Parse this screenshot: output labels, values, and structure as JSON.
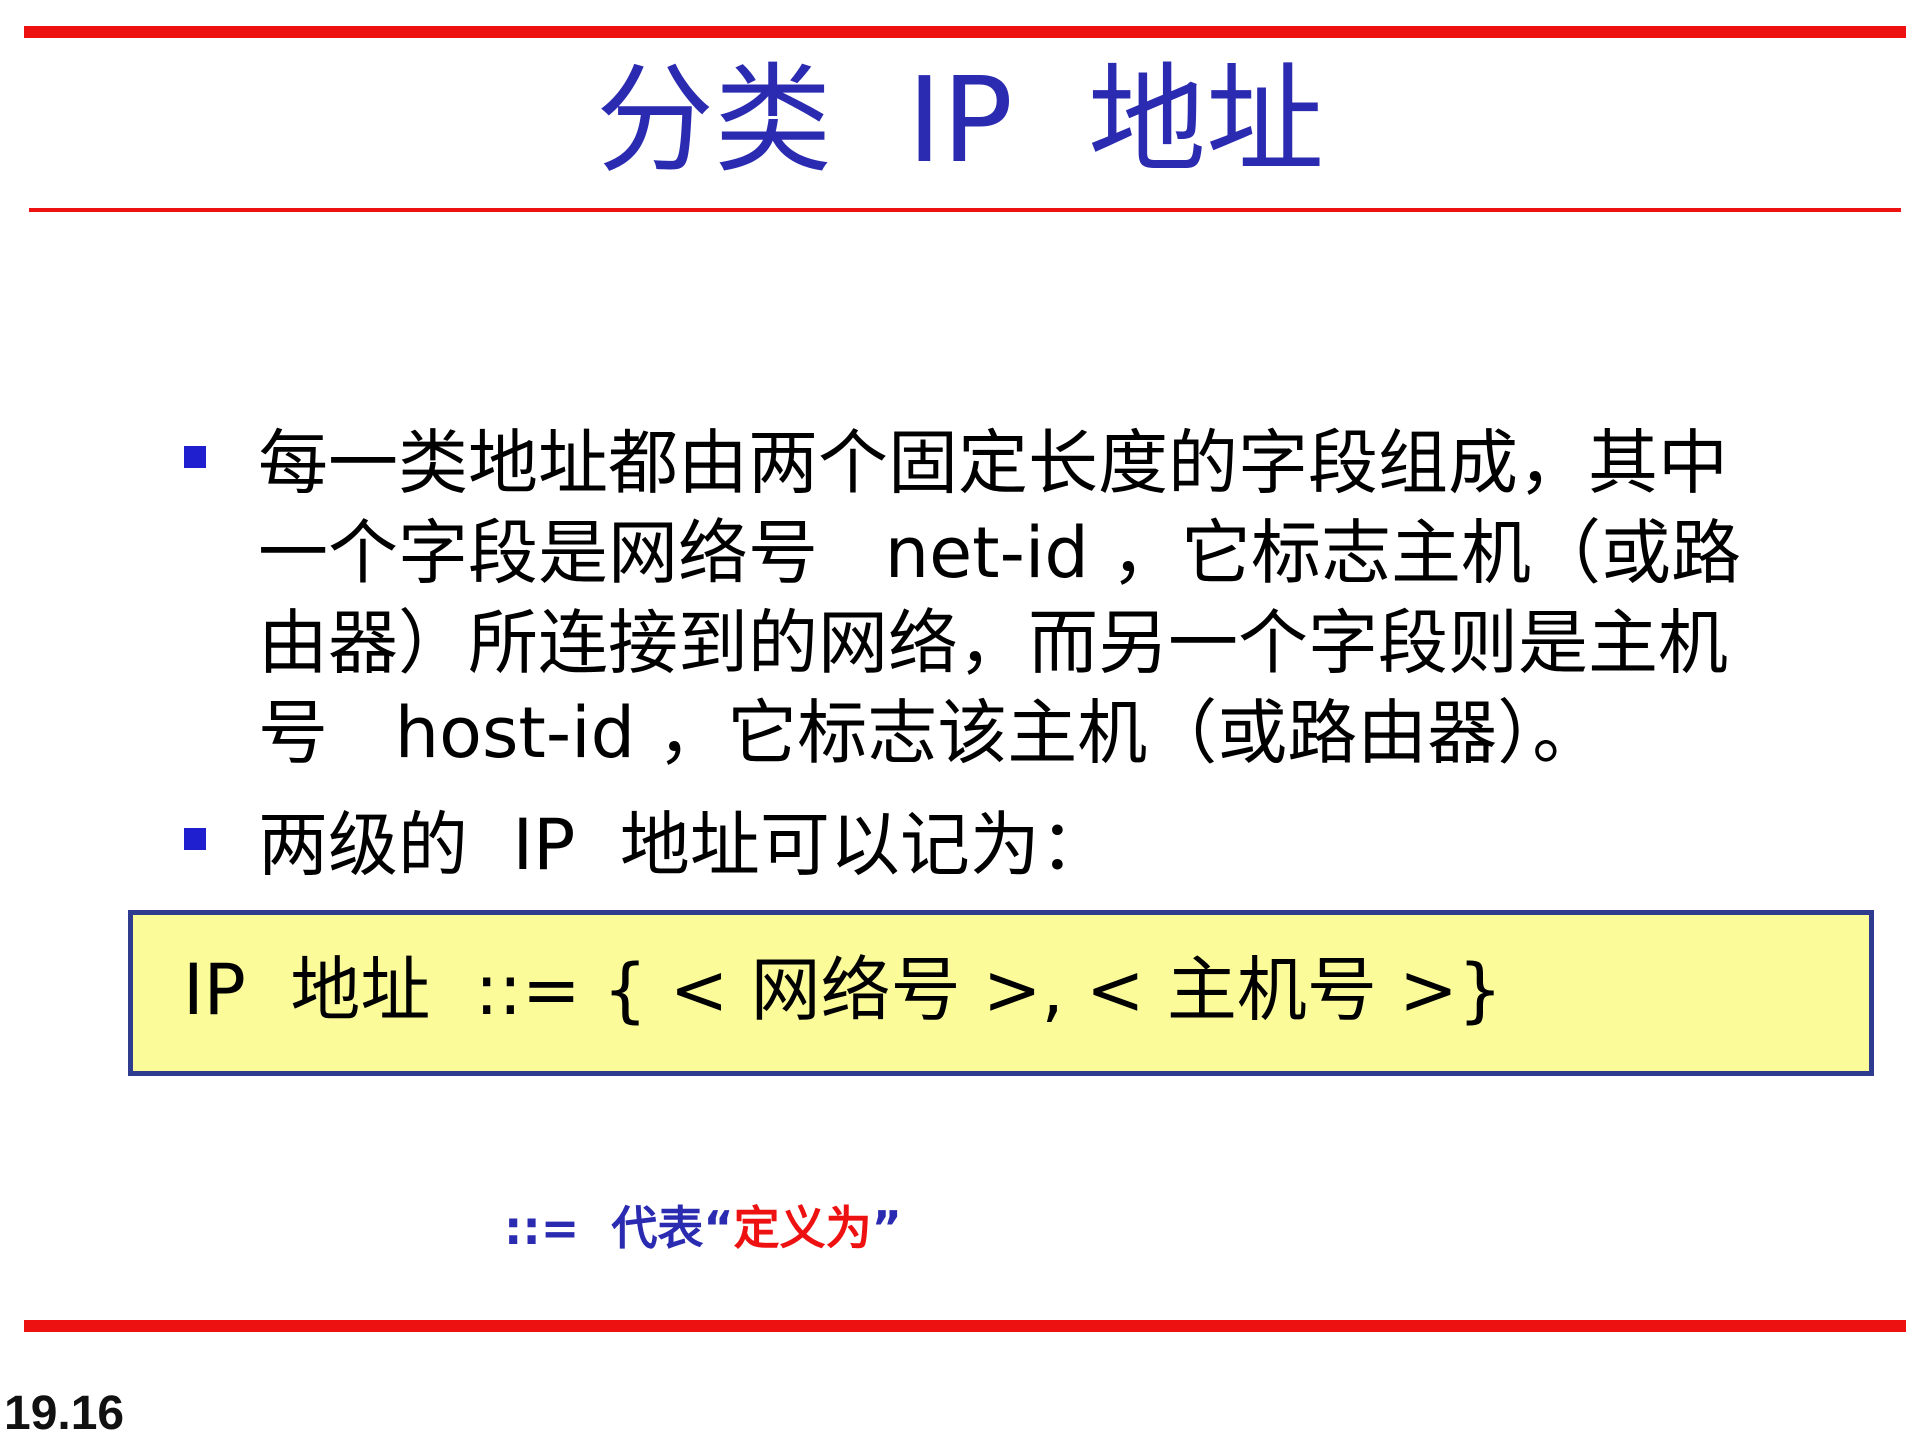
{
  "slide": {
    "title": "分类  IP  地址",
    "bullets": [
      {
        "lines": [
          "每一类地址都由两个固定长度的字段组成，其中",
          "一个字段是网络号   net-id ，它标志主机（或路",
          "由器）所连接到的网络，而另一个字段则是主机",
          "号   host-id ，它标志该主机（或路由器）。"
        ]
      },
      {
        "lines": [
          "两级的  IP  地址可以记为："
        ]
      }
    ],
    "formula": "IP  地址  ::= { < 网络号 >, < 主机号 >}",
    "note": {
      "symbol": "::=",
      "desc": "代表",
      "open_quote": "“",
      "defined": "定义为",
      "close_quote": "”"
    },
    "page_number": "19.16"
  },
  "colors": {
    "accent_red": "#ee1111",
    "title_blue": "#2b2bb2",
    "bullet_blue": "#1f1fd0",
    "box_fill": "#fbfb9a",
    "box_border": "#2e3b8f"
  }
}
